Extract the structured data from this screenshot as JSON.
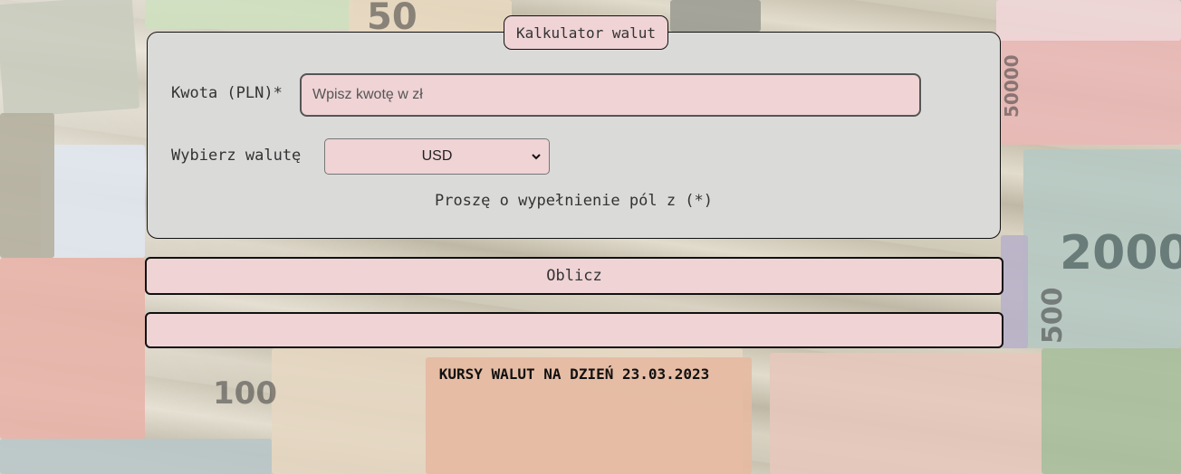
{
  "calculator": {
    "legend": "Kalkulator walut",
    "amount_label": "Kwota (PLN)*",
    "amount_placeholder": "Wpisz kwotę w zł",
    "amount_value": "",
    "currency_label": "Wybierz walutę",
    "currency_selected": "USD",
    "hint": "Proszę o wypełnienie pól z (*)"
  },
  "actions": {
    "calculate_label": "Oblicz",
    "result_text": ""
  },
  "rates": {
    "title": "KURSY WALUT NA DZIEŃ 23.03.2023"
  },
  "background": {
    "note_values": [
      "50",
      "50000",
      "2000",
      "100",
      "500"
    ],
    "colors": {
      "panel": "#dadbd9",
      "pink": "#efd3d5",
      "border": "#111111"
    }
  }
}
